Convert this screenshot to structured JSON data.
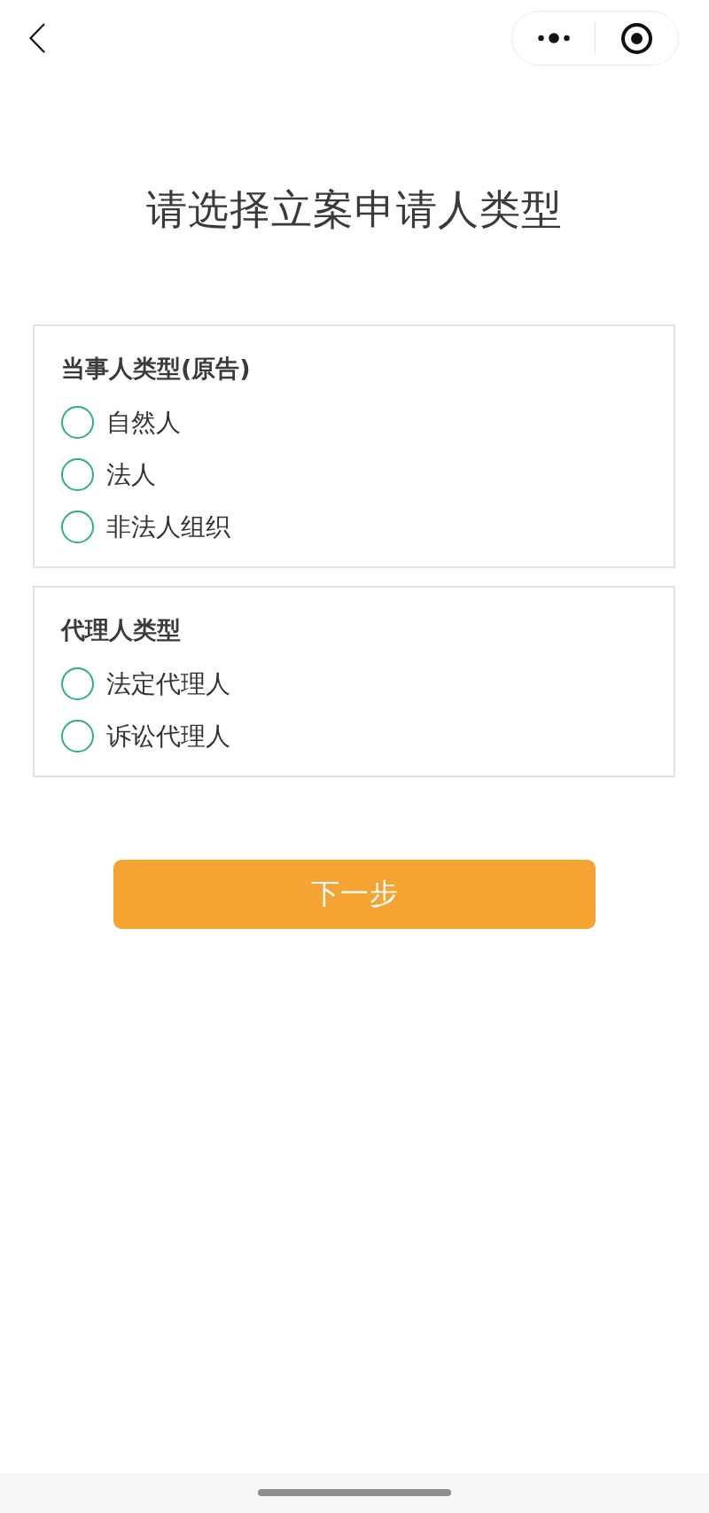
{
  "title": "请选择立案申请人类型",
  "groups": [
    {
      "heading": "当事人类型(原告)",
      "options": [
        {
          "label": "自然人",
          "selected": false
        },
        {
          "label": "法人",
          "selected": false
        },
        {
          "label": "非法人组织",
          "selected": false
        }
      ]
    },
    {
      "heading": "代理人类型",
      "options": [
        {
          "label": "法定代理人",
          "selected": false
        },
        {
          "label": "诉讼代理人",
          "selected": false
        }
      ]
    }
  ],
  "next_button": {
    "label": "下一步"
  }
}
